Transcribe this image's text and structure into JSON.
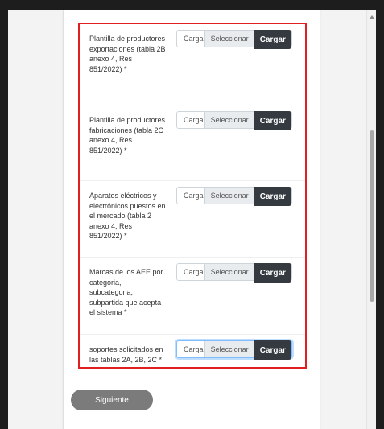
{
  "form": {
    "rows": [
      {
        "label": "Plantilla de productores exportaciones (tabla 2B anexo 4, Res 851/2022) *",
        "file_placeholder": "Cargar",
        "select_label": "Seleccionar",
        "upload_label": "Cargar"
      },
      {
        "label": "Plantilla de productores fabricaciones (tabla 2C anexo 4, Res 851/2022) *",
        "file_placeholder": "Cargar",
        "select_label": "Seleccionar",
        "upload_label": "Cargar"
      },
      {
        "label": "Aparatos eléctricos y electrónicos puestos en el mercado (tabla 2 anexo 4, Res 851/2022) *",
        "file_placeholder": "Cargar",
        "select_label": "Seleccionar",
        "upload_label": "Cargar"
      },
      {
        "label": "Marcas de los AEE por categoria, subcategoria, subpartida que acepta el sistema *",
        "file_placeholder": "Cargar",
        "select_label": "Seleccionar",
        "upload_label": "Cargar"
      },
      {
        "label": "soportes solicitados en las tablas 2A, 2B, 2C *",
        "file_placeholder": "Cargar",
        "select_label": "Seleccionar",
        "upload_label": "Cargar",
        "focused": true
      }
    ],
    "next_label": "Siguiente"
  },
  "colors": {
    "highlight_border": "#e02020",
    "upload_button": "#343a40",
    "next_button": "#7b7b7b"
  }
}
